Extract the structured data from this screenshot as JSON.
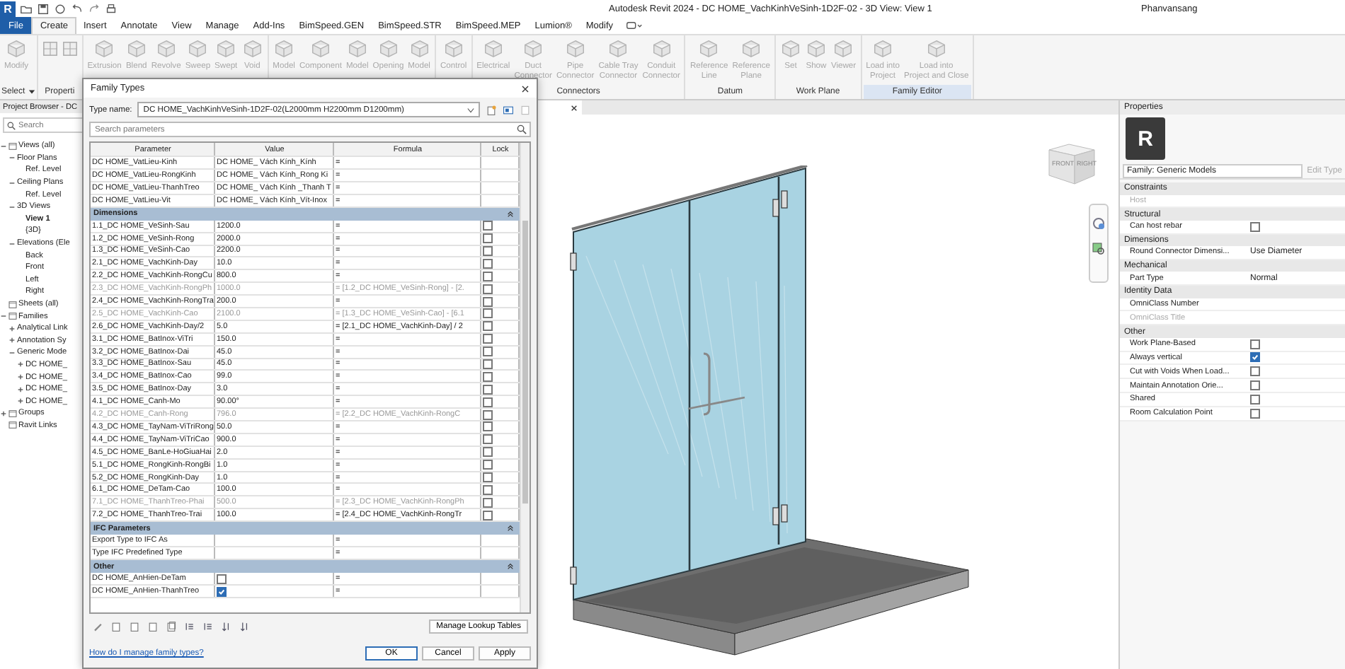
{
  "window": {
    "logo": "R",
    "title": "Autodesk Revit 2024 - DC HOME_VachKinhVeSinh-1D2F-02 - 3D View: View 1",
    "user": "Phanvansang"
  },
  "menu": [
    {
      "kind": "file",
      "label": "File",
      "selected": false
    },
    {
      "kind": "tab",
      "label": "Create",
      "selected": true
    },
    {
      "kind": "tab",
      "label": "Insert",
      "selected": false
    },
    {
      "kind": "tab",
      "label": "Annotate",
      "selected": false
    },
    {
      "kind": "tab",
      "label": "View",
      "selected": false
    },
    {
      "kind": "tab",
      "label": "Manage",
      "selected": false
    },
    {
      "kind": "tab",
      "label": "Add-Ins",
      "selected": false
    },
    {
      "kind": "tab",
      "label": "BimSpeed.GEN",
      "selected": false
    },
    {
      "kind": "tab",
      "label": "BimSpeed.STR",
      "selected": false
    },
    {
      "kind": "tab",
      "label": "BimSpeed.MEP",
      "selected": false
    },
    {
      "kind": "tab",
      "label": "Lumion®",
      "selected": false
    },
    {
      "kind": "tab",
      "label": "Modify",
      "selected": false
    }
  ],
  "ribbon": [
    {
      "label": "Select",
      "dropdown": true,
      "highlighted": false,
      "tools": [
        {
          "lines": [
            "Modify"
          ],
          "disabled": true
        }
      ]
    },
    {
      "label": "Properti",
      "dropdown": false,
      "highlighted": false,
      "tools": [
        {
          "disabled": true
        },
        {
          "disabled": true
        }
      ]
    },
    {
      "tools": [
        {
          "lines": [
            "Extrusion"
          ],
          "disabled": true
        },
        {
          "lines": [
            "Blend"
          ],
          "disabled": true
        },
        {
          "lines": [
            "Revolve"
          ],
          "disabled": true
        },
        {
          "lines": [
            "Sweep"
          ],
          "disabled": true
        },
        {
          "lines": [
            "Swept"
          ],
          "disabled": true
        },
        {
          "lines": [
            "Void"
          ],
          "disabled": true
        }
      ]
    },
    {
      "tools": [
        {
          "lines": [
            "Model"
          ],
          "disabled": true
        },
        {
          "lines": [
            "Component"
          ],
          "disabled": true
        },
        {
          "lines": [
            "Model"
          ],
          "disabled": true
        },
        {
          "lines": [
            "Opening"
          ],
          "disabled": true
        },
        {
          "lines": [
            "Model"
          ],
          "disabled": true
        }
      ]
    },
    {
      "tools": [
        {
          "lines": [
            "Control"
          ],
          "disabled": true
        }
      ]
    },
    {
      "label": "Connectors",
      "dropdown": false,
      "highlighted": false,
      "tools": [
        {
          "lines": [
            "Electrical"
          ],
          "disabled": true
        },
        {
          "lines": [
            "Duct",
            "Connector"
          ],
          "disabled": true
        },
        {
          "lines": [
            "Pipe",
            "Connector"
          ],
          "disabled": true
        },
        {
          "lines": [
            "Cable Tray",
            "Connector"
          ],
          "disabled": true
        },
        {
          "lines": [
            "Conduit",
            "Connector"
          ],
          "disabled": true
        }
      ]
    },
    {
      "label": "Datum",
      "dropdown": false,
      "highlighted": false,
      "tools": [
        {
          "lines": [
            "Reference",
            "Line"
          ],
          "disabled": true
        },
        {
          "lines": [
            "Reference",
            "Plane"
          ],
          "disabled": true
        }
      ]
    },
    {
      "label": "Work Plane",
      "dropdown": false,
      "highlighted": false,
      "tools": [
        {
          "lines": [
            "Set"
          ],
          "disabled": true
        },
        {
          "lines": [
            "Show"
          ],
          "disabled": true
        },
        {
          "lines": [
            "Viewer"
          ],
          "disabled": true
        }
      ]
    },
    {
      "label": "Family Editor",
      "dropdown": false,
      "highlighted": true,
      "tools": [
        {
          "lines": [
            "Load into",
            "Project"
          ],
          "disabled": true
        },
        {
          "lines": [
            "Load into",
            "Project and Close"
          ],
          "disabled": true
        }
      ]
    }
  ],
  "browser": {
    "title": "Project Browser - DC",
    "search": {
      "placeholder": "Search"
    },
    "tree": [
      {
        "label": "Views (all)",
        "expanded": true,
        "selected": false,
        "children": [
          {
            "label": "Floor Plans",
            "expanded": true,
            "selected": false,
            "children": [
              {
                "label": "Ref. Level",
                "selected": false
              }
            ]
          },
          {
            "label": "Ceiling Plans",
            "expanded": true,
            "selected": false,
            "children": [
              {
                "label": "Ref. Level",
                "selected": false
              }
            ]
          },
          {
            "label": "3D Views",
            "expanded": true,
            "selected": false,
            "children": [
              {
                "label": "View 1",
                "selected": true
              },
              {
                "label": "{3D}",
                "selected": false
              }
            ]
          },
          {
            "label": "Elevations (Ele",
            "expanded": true,
            "selected": false,
            "children": [
              {
                "label": "Back",
                "selected": false
              },
              {
                "label": "Front",
                "selected": false
              },
              {
                "label": "Left",
                "selected": false
              },
              {
                "label": "Right",
                "selected": false
              }
            ]
          }
        ]
      },
      {
        "label": "Sheets (all)",
        "selected": false
      },
      {
        "label": "Families",
        "expanded": true,
        "selected": false,
        "children": [
          {
            "label": "Analytical Link",
            "expanded": false,
            "selected": false
          },
          {
            "label": "Annotation Sy",
            "expanded": false,
            "selected": false
          },
          {
            "label": "Generic Mode",
            "expanded": true,
            "selected": false,
            "children": [
              {
                "label": "DC HOME_",
                "expanded": false,
                "selected": false
              },
              {
                "label": "DC HOME_",
                "expanded": false,
                "selected": false
              },
              {
                "label": "DC HOME_",
                "expanded": false,
                "selected": false
              },
              {
                "label": "DC HOME_",
                "expanded": false,
                "selected": false
              }
            ]
          }
        ]
      },
      {
        "label": "Groups",
        "expanded": false,
        "selected": false
      },
      {
        "label": "Ravit Links",
        "selected": false
      }
    ]
  },
  "view": {
    "cube": {
      "front": "FRONT",
      "right": "RIGHT"
    }
  },
  "dialog": {
    "title": "Family Types",
    "type_name": {
      "label": "Type name:",
      "value": "DC HOME_VachKinhVeSinh-1D2F-02(L2000mm H2200mm D1200mm)"
    },
    "search": {
      "placeholder": "Search parameters"
    },
    "columns": [
      "Parameter",
      "Value",
      "Formula",
      "Lock"
    ],
    "sections": [
      {
        "rows": [
          {
            "kind": "text",
            "parameter": "DC HOME_VatLieu-Kinh",
            "value": "DC HOME_ Vách Kính_Kính",
            "formula": "=",
            "disabled": false
          },
          {
            "kind": "text",
            "parameter": "DC HOME_VatLieu-RongKinh",
            "value": "DC HOME_ Vách Kính_Rong Ki",
            "formula": "=",
            "disabled": false
          },
          {
            "kind": "text",
            "parameter": "DC HOME_VatLieu-ThanhTreo",
            "value": "DC HOME_ Vách Kính _Thanh T",
            "formula": "=",
            "disabled": false
          },
          {
            "kind": "text",
            "parameter": "DC HOME_VatLieu-Vit",
            "value": "DC HOME_ Vách Kính_Vít-Inox",
            "formula": "=",
            "disabled": false
          }
        ]
      },
      {
        "title": "Dimensions",
        "rows": [
          {
            "kind": "text",
            "parameter": "1.1_DC HOME_VeSinh-Sau",
            "value": "1200.0",
            "formula": "=",
            "lock": false,
            "disabled": false
          },
          {
            "kind": "text",
            "parameter": "1.2_DC HOME_VeSinh-Rong",
            "value": "2000.0",
            "formula": "=",
            "lock": false,
            "disabled": false
          },
          {
            "kind": "text",
            "parameter": "1.3_DC HOME_VeSinh-Cao",
            "value": "2200.0",
            "formula": "=",
            "lock": false,
            "disabled": false
          },
          {
            "kind": "text",
            "parameter": "2.1_DC HOME_VachKinh-Day",
            "value": "10.0",
            "formula": "=",
            "lock": false,
            "disabled": false
          },
          {
            "kind": "text",
            "parameter": "2.2_DC HOME_VachKinh-RongCu",
            "value": "800.0",
            "formula": "=",
            "lock": false,
            "disabled": false
          },
          {
            "kind": "text",
            "parameter": "2.3_DC HOME_VachKinh-RongPh",
            "value": "1000.0",
            "formula": "= [1.2_DC HOME_VeSinh-Rong] - [2.",
            "lock": false,
            "disabled": true
          },
          {
            "kind": "text",
            "parameter": "2.4_DC HOME_VachKinh-RongTra",
            "value": "200.0",
            "formula": "=",
            "lock": false,
            "disabled": false
          },
          {
            "kind": "text",
            "parameter": "2.5_DC HOME_VachKinh-Cao",
            "value": "2100.0",
            "formula": "= [1.3_DC HOME_VeSinh-Cao] - [6.1",
            "lock": false,
            "disabled": true
          },
          {
            "kind": "text",
            "parameter": "2.6_DC HOME_VachKinh-Day/2",
            "value": "5.0",
            "formula": "= [2.1_DC HOME_VachKinh-Day] / 2",
            "lock": false,
            "disabled": false
          },
          {
            "kind": "text",
            "parameter": "3.1_DC HOME_BatInox-ViTri",
            "value": "150.0",
            "formula": "=",
            "lock": false,
            "disabled": false
          },
          {
            "kind": "text",
            "parameter": "3.2_DC HOME_BatInox-Dai",
            "value": "45.0",
            "formula": "=",
            "lock": false,
            "disabled": false
          },
          {
            "kind": "text",
            "parameter": "3.3_DC HOME_BatInox-Sau",
            "value": "45.0",
            "formula": "=",
            "lock": false,
            "disabled": false
          },
          {
            "kind": "text",
            "parameter": "3.4_DC HOME_BatInox-Cao",
            "value": "99.0",
            "formula": "=",
            "lock": false,
            "disabled": false
          },
          {
            "kind": "text",
            "parameter": "3.5_DC HOME_BatInox-Day",
            "value": "3.0",
            "formula": "=",
            "lock": false,
            "disabled": false
          },
          {
            "kind": "text",
            "parameter": "4.1_DC HOME_Canh-Mo",
            "value": "90.00°",
            "formula": "=",
            "lock": false,
            "disabled": false
          },
          {
            "kind": "text",
            "parameter": "4.2_DC HOME_Canh-Rong",
            "value": "796.0",
            "formula": "= [2.2_DC HOME_VachKinh-RongC",
            "lock": false,
            "disabled": true
          },
          {
            "kind": "text",
            "parameter": "4.3_DC HOME_TayNam-ViTriRong",
            "value": "50.0",
            "formula": "=",
            "lock": false,
            "disabled": false
          },
          {
            "kind": "text",
            "parameter": "4.4_DC HOME_TayNam-ViTriCao",
            "value": "900.0",
            "formula": "=",
            "lock": false,
            "disabled": false
          },
          {
            "kind": "text",
            "parameter": "4.5_DC HOME_BanLe-HoGiuaHai",
            "value": "2.0",
            "formula": "=",
            "lock": false,
            "disabled": false
          },
          {
            "kind": "text",
            "parameter": "5.1_DC HOME_RongKinh-RongBi",
            "value": "1.0",
            "formula": "=",
            "lock": false,
            "disabled": false
          },
          {
            "kind": "text",
            "parameter": "5.2_DC HOME_RongKinh-Day",
            "value": "1.0",
            "formula": "=",
            "lock": false,
            "disabled": false
          },
          {
            "kind": "text",
            "parameter": "6.1_DC HOME_DeTam-Cao",
            "value": "100.0",
            "formula": "=",
            "lock": false,
            "disabled": false
          },
          {
            "kind": "text",
            "parameter": "7.1_DC HOME_ThanhTreo-Phai",
            "value": "500.0",
            "formula": "= [2.3_DC HOME_VachKinh-RongPh",
            "lock": false,
            "disabled": true
          },
          {
            "kind": "text",
            "parameter": "7.2_DC HOME_ThanhTreo-Trai",
            "value": "100.0",
            "formula": "= [2.4_DC HOME_VachKinh-RongTr",
            "lock": false,
            "disabled": false
          }
        ]
      },
      {
        "title": "IFC Parameters",
        "rows": [
          {
            "kind": "text",
            "parameter": "Export Type to IFC As",
            "formula": "=",
            "disabled": false
          },
          {
            "kind": "text",
            "parameter": "Type IFC Predefined Type",
            "formula": "=",
            "disabled": false
          }
        ]
      },
      {
        "title": "Other",
        "rows": [
          {
            "kind": "yesno",
            "parameter": "DC HOME_AnHien-DeTam",
            "checked": false,
            "formula": "=",
            "disabled": false
          },
          {
            "kind": "yesno",
            "parameter": "DC HOME_AnHien-ThanhTreo",
            "checked": true,
            "formula": "=",
            "disabled": false
          }
        ]
      }
    ],
    "lookup_button": "Manage Lookup Tables",
    "help_link": "How do I manage family types?",
    "buttons": [
      "OK",
      "Cancel",
      "Apply"
    ]
  },
  "properties": {
    "title": "Properties",
    "logo": "R",
    "family": "Family: Generic Models",
    "edit_type": {
      "label": "Edit Type",
      "disabled": true
    },
    "groups": [
      {
        "title": "Constraints",
        "rows": [
          {
            "kind": "text",
            "label": "Host",
            "disabled": true
          }
        ]
      },
      {
        "title": "Structural",
        "rows": [
          {
            "kind": "check",
            "label": "Can host rebar",
            "checked": false,
            "disabled": false
          }
        ]
      },
      {
        "title": "Dimensions",
        "rows": [
          {
            "kind": "text",
            "label": "Round Connector Dimensi...",
            "value": "Use Diameter",
            "disabled": false
          }
        ]
      },
      {
        "title": "Mechanical",
        "rows": [
          {
            "kind": "text",
            "label": "Part Type",
            "value": "Normal",
            "disabled": false
          }
        ]
      },
      {
        "title": "Identity Data",
        "rows": [
          {
            "kind": "text",
            "label": "OmniClass Number",
            "disabled": false
          },
          {
            "kind": "text",
            "label": "OmniClass Title",
            "disabled": true
          }
        ]
      },
      {
        "title": "Other",
        "rows": [
          {
            "kind": "check",
            "label": "Work Plane-Based",
            "checked": false,
            "disabled": false
          },
          {
            "kind": "check",
            "label": "Always vertical",
            "checked": true,
            "disabled": false
          },
          {
            "kind": "check",
            "label": "Cut with Voids When Load...",
            "checked": false,
            "disabled": false
          },
          {
            "kind": "check",
            "label": "Maintain Annotation Orie...",
            "checked": false,
            "disabled": false
          },
          {
            "kind": "check",
            "label": "Shared",
            "checked": false,
            "disabled": false
          },
          {
            "kind": "check",
            "label": "Room Calculation Point",
            "checked": false,
            "disabled": false
          }
        ]
      }
    ]
  }
}
